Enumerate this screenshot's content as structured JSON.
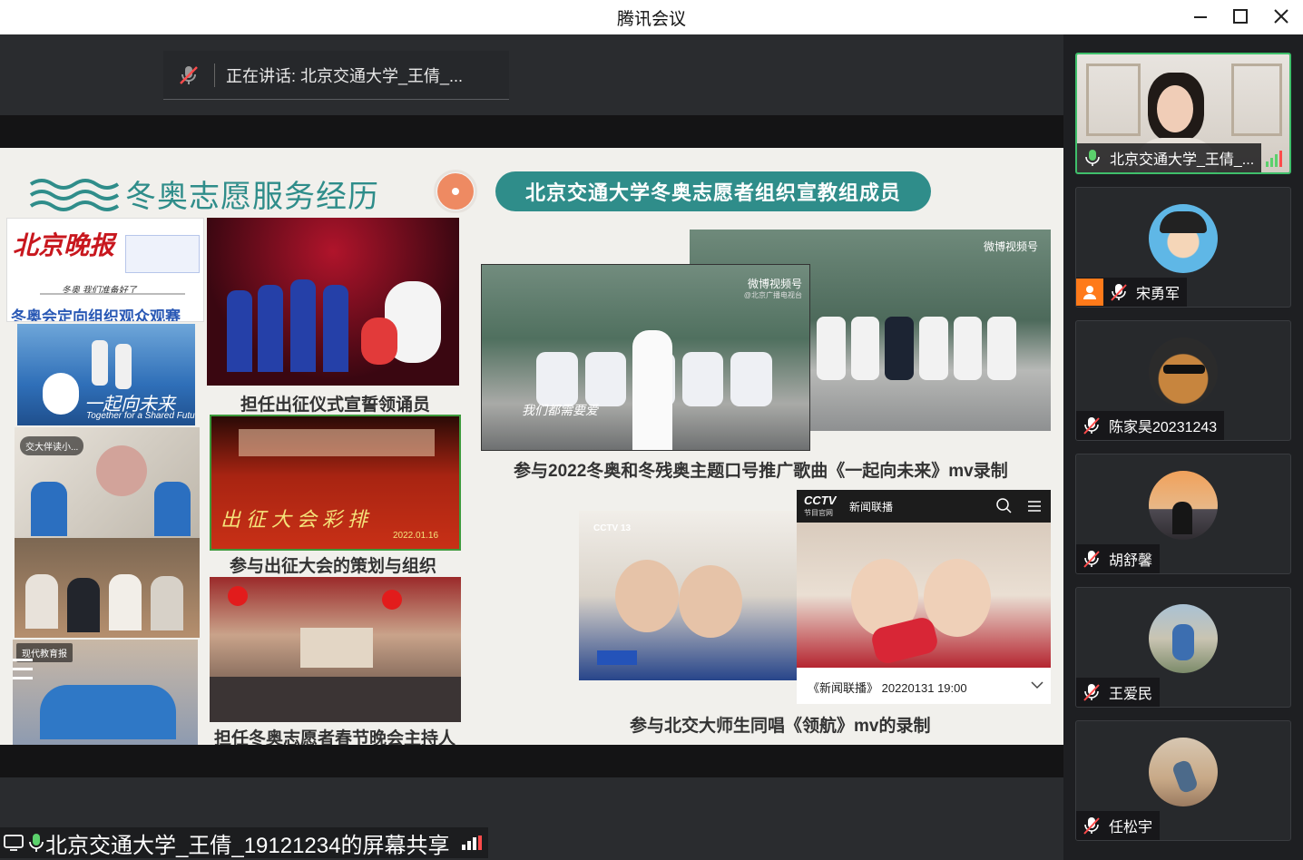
{
  "window": {
    "title": "腾讯会议"
  },
  "stage": {
    "speaking_label": "正在讲话: 北京交通大学_王倩_..."
  },
  "slide": {
    "heading": "冬奥志愿服务经历",
    "pill": "北京交通大学冬奥志愿者组织宣教组成员",
    "newspaper": {
      "masthead": "北京晚报",
      "slogan": "冬奥 我们准备好了",
      "headline": "冬奥会定向组织观众观赛",
      "poster_text": "一起向未来",
      "poster_sub": "Together for a Shared Futu"
    },
    "tags": {
      "video1": "交大伴读小...",
      "video2": "现代教育报"
    },
    "weibo_mark": "微博视频号",
    "weibo_sub": "@北京广播电视台",
    "mv_overlay": "我们都需要爱",
    "rally_banner": "出征大会彩排",
    "rally_date": "2022.01.16",
    "cctv": {
      "logo": "CCTV",
      "sub": "节目官网",
      "channel": "新闻联播",
      "footer": "《新闻联播》 20220131 19:00",
      "cctv13": "CCTV 13"
    },
    "captions": {
      "oath": "担任出征仪式宣誓领诵员",
      "mv2022": "参与2022冬奥和冬残奥主题口号推广歌曲《一起向未来》mv录制",
      "rally": "参与出征大会的策划与组织",
      "gala": "担任冬奥志愿者春节晚会主持人",
      "lh": "参与北交大师生同唱《领航》mv的录制"
    }
  },
  "participants": [
    {
      "name": "北京交通大学_王倩_...",
      "mic": "on",
      "active": true
    },
    {
      "name": "宋勇军",
      "mic": "muted",
      "host": true
    },
    {
      "name": "陈家昊20231243",
      "mic": "muted"
    },
    {
      "name": "胡舒馨",
      "mic": "muted"
    },
    {
      "name": "王爱民",
      "mic": "muted"
    },
    {
      "name": "任松宇",
      "mic": "muted"
    }
  ],
  "share_label": "北京交通大学_王倩_19121234的屏幕共享",
  "colors": {
    "accent_teal": "#2f8d8a",
    "accent_orange": "#ee8a62",
    "active_border": "#3fbf6b"
  }
}
